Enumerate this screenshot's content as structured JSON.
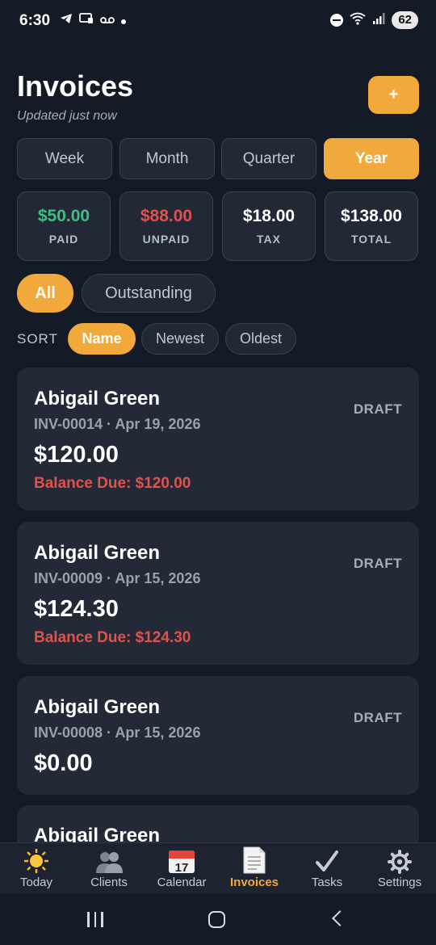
{
  "status_bar": {
    "time": "6:30",
    "battery": "62",
    "left_icons": [
      "telegram-icon",
      "cast-icon",
      "voicemail-icon",
      "dot-icon"
    ],
    "right_icons": [
      "dnd-icon",
      "wifi-icon",
      "signal-icon"
    ]
  },
  "header": {
    "title": "Invoices",
    "subtitle": "Updated just now",
    "add_label": "+"
  },
  "period_tabs": [
    "Week",
    "Month",
    "Quarter",
    "Year"
  ],
  "period_selected": "Year",
  "stats": [
    {
      "value": "$50.00",
      "label": "PAID",
      "color": "#3fbf7f"
    },
    {
      "value": "$88.00",
      "label": "UNPAID",
      "color": "#e0524a"
    },
    {
      "value": "$18.00",
      "label": "TAX",
      "color": "#ffffff"
    },
    {
      "value": "$138.00",
      "label": "TOTAL",
      "color": "#ffffff"
    }
  ],
  "filters": {
    "items": [
      "All",
      "Outstanding"
    ],
    "selected": "All"
  },
  "sort": {
    "label": "SORT",
    "options": [
      "Name",
      "Newest",
      "Oldest"
    ],
    "selected": "Name"
  },
  "invoices": [
    {
      "client": "Abigail Green",
      "meta": "INV-00014 · Apr 19, 2026",
      "amount": "$120.00",
      "balance": "Balance Due: $120.00",
      "status": "DRAFT"
    },
    {
      "client": "Abigail Green",
      "meta": "INV-00009 · Apr 15, 2026",
      "amount": "$124.30",
      "balance": "Balance Due: $124.30",
      "status": "DRAFT"
    },
    {
      "client": "Abigail Green",
      "meta": "INV-00008 · Apr 15, 2026",
      "amount": "$0.00",
      "balance": "",
      "status": "DRAFT"
    },
    {
      "client": "Abigail Green",
      "meta": "",
      "amount": "",
      "balance": "",
      "status": ""
    }
  ],
  "tabbar": {
    "items": [
      {
        "label": "Today",
        "icon": "sun-icon",
        "glyph": "☀"
      },
      {
        "label": "Clients",
        "icon": "people-icon",
        "glyph": "👥"
      },
      {
        "label": "Calendar",
        "icon": "calendar-icon",
        "glyph": "17"
      },
      {
        "label": "Invoices",
        "icon": "invoice-icon",
        "glyph": "📄"
      },
      {
        "label": "Tasks",
        "icon": "check-icon",
        "glyph": "✓"
      },
      {
        "label": "Settings",
        "icon": "gear-icon",
        "glyph": "⚙"
      }
    ],
    "active": "Invoices"
  },
  "colors": {
    "accent": "#f2a93b",
    "background": "#141a26",
    "card": "#232937",
    "paid": "#3fbf7f",
    "unpaid": "#e0524a"
  }
}
